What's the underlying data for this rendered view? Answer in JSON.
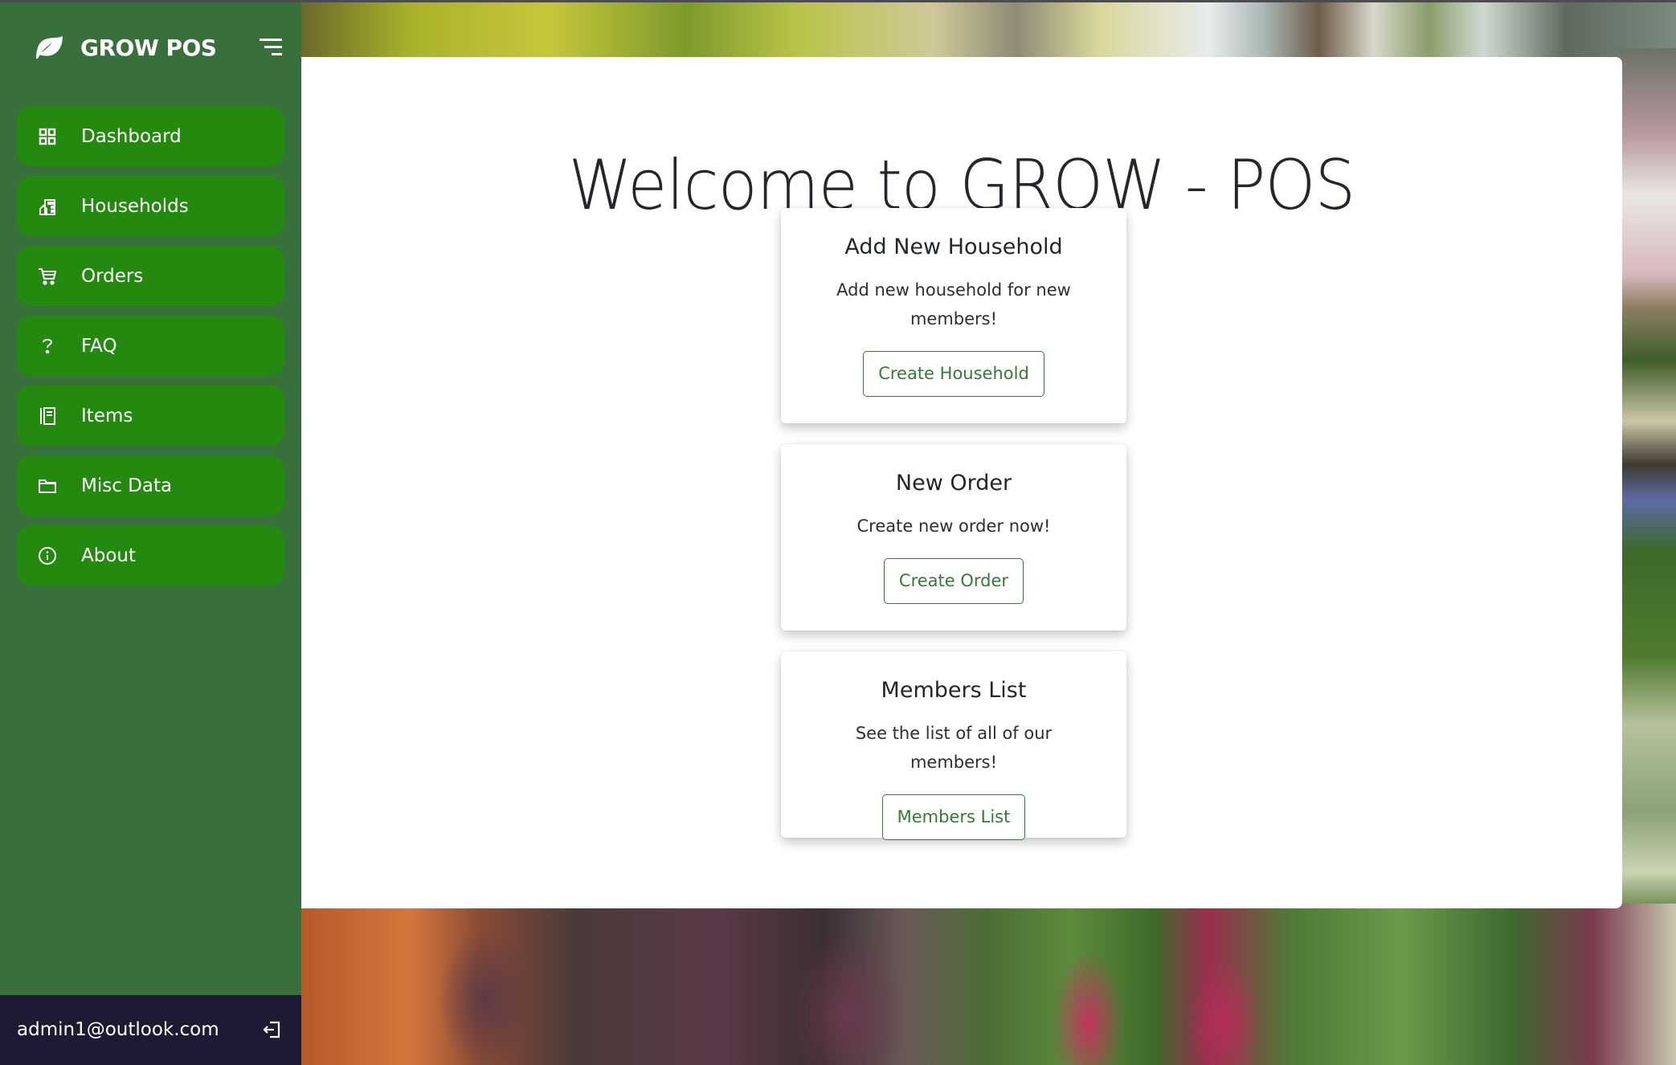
{
  "app": {
    "brand_name": "GROW POS",
    "brand_icon": "leaf-icon",
    "menu_toggle_icon": "menu-lines-icon"
  },
  "colors": {
    "sidebar_bg": "#37703a",
    "nav_item_bg": "#238a0f",
    "footer_bg": "#1d1b33",
    "accent": "#357a38",
    "text_dark": "#23272b"
  },
  "sidebar": {
    "items": [
      {
        "label": "Dashboard",
        "icon": "grid-icon"
      },
      {
        "label": "Households",
        "icon": "building-icon"
      },
      {
        "label": "Orders",
        "icon": "cart-icon"
      },
      {
        "label": "FAQ",
        "icon": "question-icon"
      },
      {
        "label": "Items",
        "icon": "journal-icon"
      },
      {
        "label": "Misc Data",
        "icon": "folder-icon"
      },
      {
        "label": "About",
        "icon": "info-circle-icon"
      }
    ],
    "user_email": "admin1@outlook.com",
    "logout_icon": "logout-icon"
  },
  "main": {
    "title": "Welcome to GROW - POS",
    "cards": [
      {
        "title": "Add New Household",
        "text": "Add new household for new members!",
        "button": "Create Household"
      },
      {
        "title": "New Order",
        "text": "Create new order now!",
        "button": "Create Order"
      },
      {
        "title": "Members List",
        "text": "See the list of all of our members!",
        "button": "Members List"
      }
    ]
  }
}
